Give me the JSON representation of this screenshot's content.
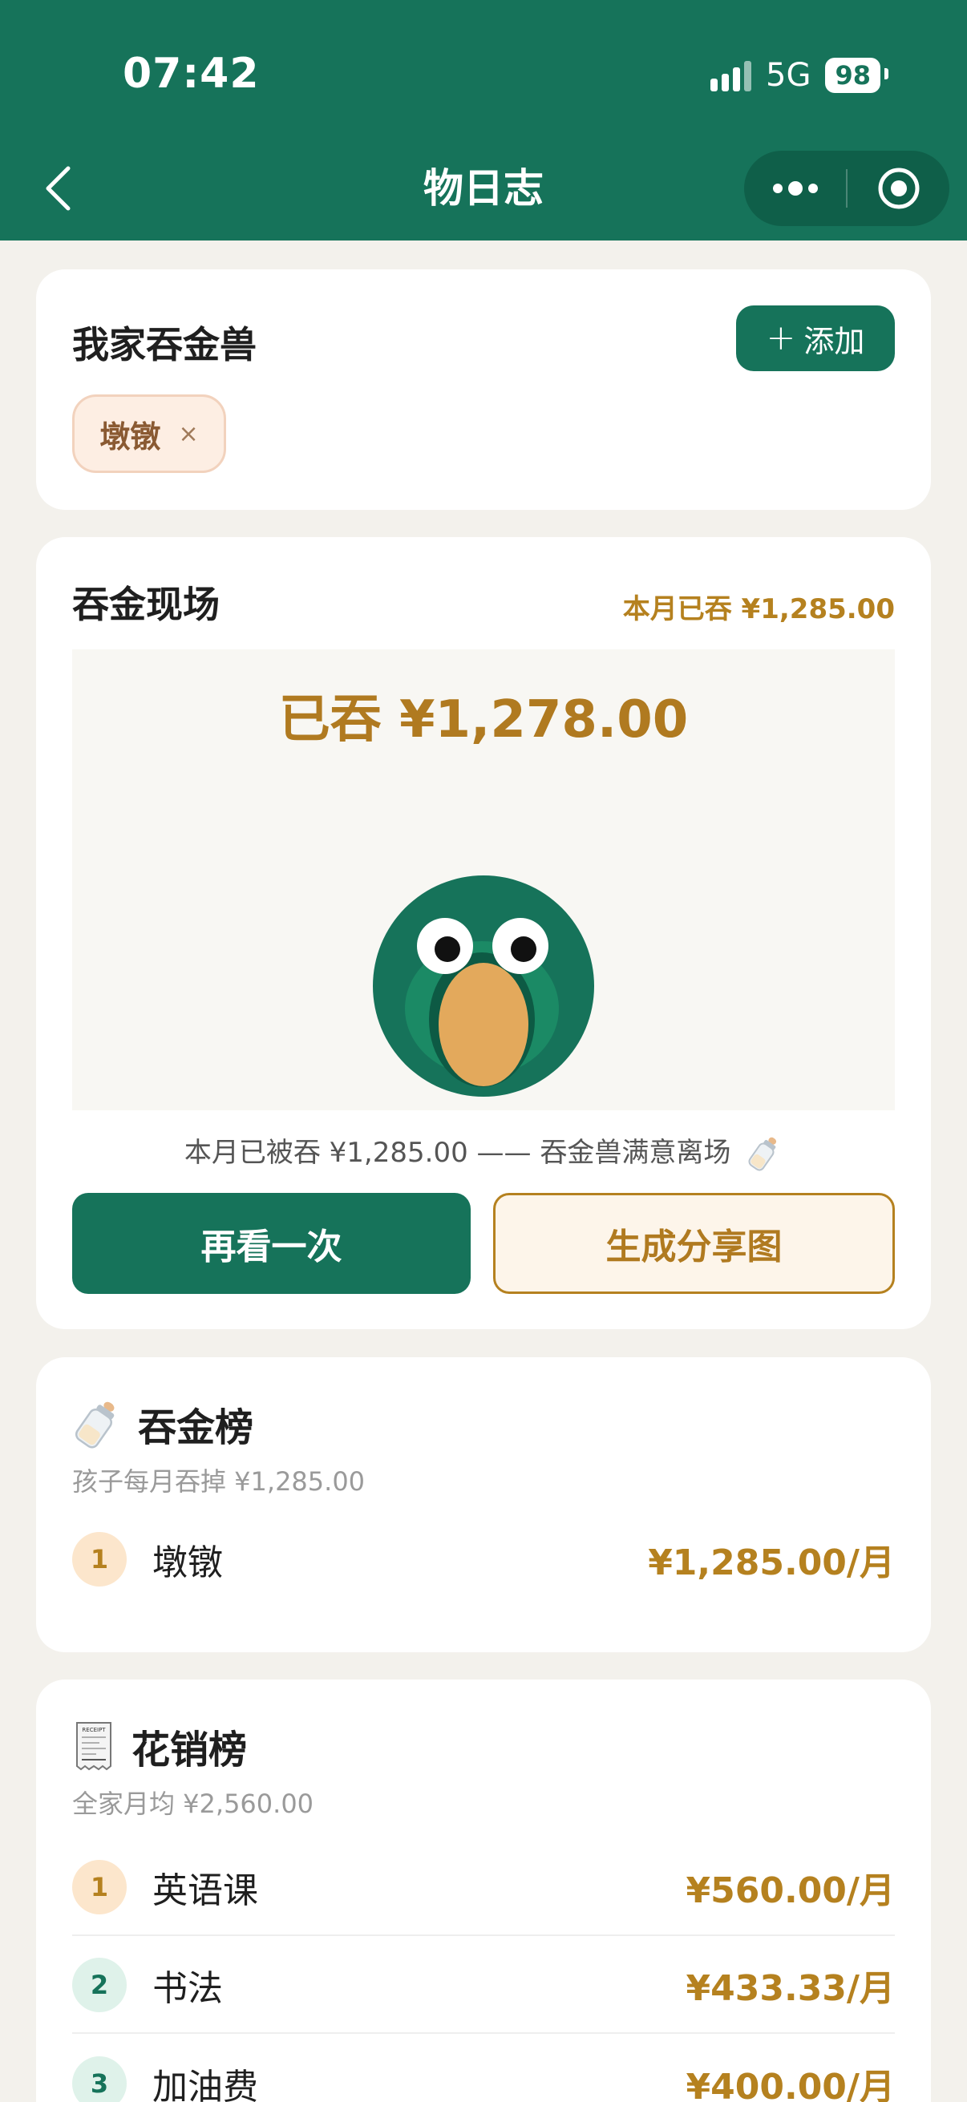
{
  "status_bar": {
    "time": "07:42",
    "network": "5G",
    "battery": "98"
  },
  "nav": {
    "title": "物日志"
  },
  "pets": {
    "title": "我家吞金兽",
    "add_label": "添加",
    "chips": [
      {
        "name": "墩镦",
        "remove": "×"
      }
    ]
  },
  "scene": {
    "title": "吞金现场",
    "month_total": "本月已吞 ¥1,285.00",
    "swallowed": "已吞 ¥1,278.00",
    "caption": "本月已被吞 ¥1,285.00 —— 吞金兽满意离场",
    "replay_label": "再看一次",
    "share_label": "生成分享图"
  },
  "swallow_rank": {
    "icon": "baby-bottle-icon",
    "title": "吞金榜",
    "subtitle": "孩子每月吞掉 ¥1,285.00",
    "items": [
      {
        "rank": "1",
        "name": "墩镦",
        "amount": "¥1,285.00/月"
      }
    ]
  },
  "spend_rank": {
    "icon": "receipt-icon",
    "receipt_text": "RECEIPT",
    "title": "花销榜",
    "subtitle": "全家月均 ¥2,560.00",
    "items": [
      {
        "rank": "1",
        "name": "英语课",
        "amount": "¥560.00/月"
      },
      {
        "rank": "2",
        "name": "书法",
        "amount": "¥433.33/月"
      },
      {
        "rank": "3",
        "name": "加油费",
        "amount": "¥400.00/月"
      }
    ]
  },
  "colors": {
    "primary": "#16735a",
    "gold": "#b5811f",
    "background": "#f3f1ec"
  }
}
